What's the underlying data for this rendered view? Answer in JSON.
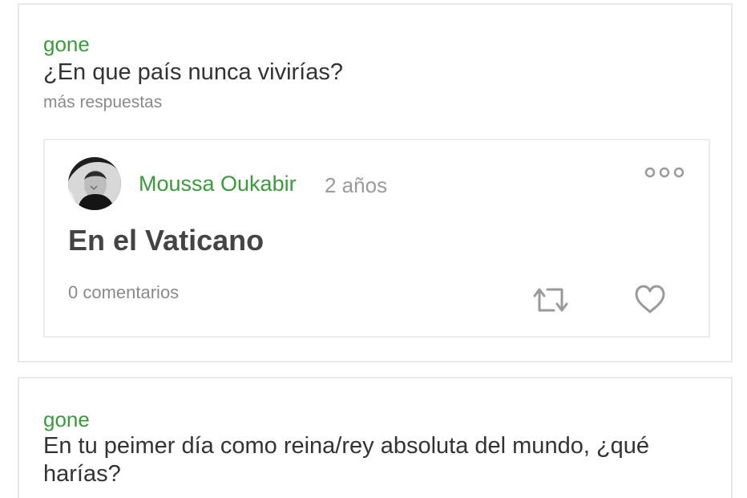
{
  "feed": {
    "posts": [
      {
        "user": "gone",
        "question": "¿En que país nunca vivirías?",
        "more_label": "más respuestas",
        "answer": {
          "author": "Moussa Oukabir",
          "time": "2 años",
          "text": "En el Vaticano",
          "comments": "0 comentarios",
          "menu_icon": "more-dots-icon",
          "share_icon": "repost-icon",
          "like_icon": "heart-icon"
        }
      },
      {
        "user": "gone",
        "question_line1": "En tu peimer día como reina/rey absoluta del mundo, ¿qué",
        "question_line2": "harías?"
      }
    ]
  },
  "colors": {
    "user_link": "#3b9a3b",
    "text": "#333333",
    "muted": "#8a8a8a",
    "border": "#e8e8e8"
  }
}
